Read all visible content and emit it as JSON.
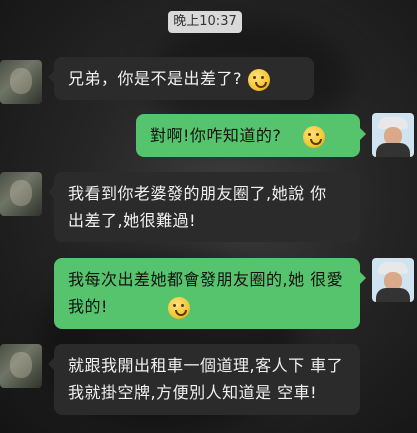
{
  "time_label": "晚上10:37",
  "messages": [
    {
      "side": "in",
      "text": "兄弟，你是不是出差了?",
      "emoji": "worried-face-emoji"
    },
    {
      "side": "out",
      "text": "對啊!你咋知道的?",
      "emoji": "crying-face-emoji"
    },
    {
      "side": "in",
      "line1": "我看到你老婆發的朋友圈了,她說 你",
      "line2": "出差了,她很難過!"
    },
    {
      "side": "out",
      "line1": "我每次出差她都會發朋友圈的,她 很愛",
      "line2": "我的!",
      "emoji": "thinking-face-emoji"
    },
    {
      "side": "in",
      "line1": "就跟我開出租車一個道理,客人下 車了",
      "line2": "我就掛空牌,方便別人知道是 空車!"
    }
  ],
  "colors": {
    "incoming_bubble": "#2b2b2b",
    "outgoing_bubble": "#56c46c",
    "time_chip": "#d9d9d9"
  }
}
